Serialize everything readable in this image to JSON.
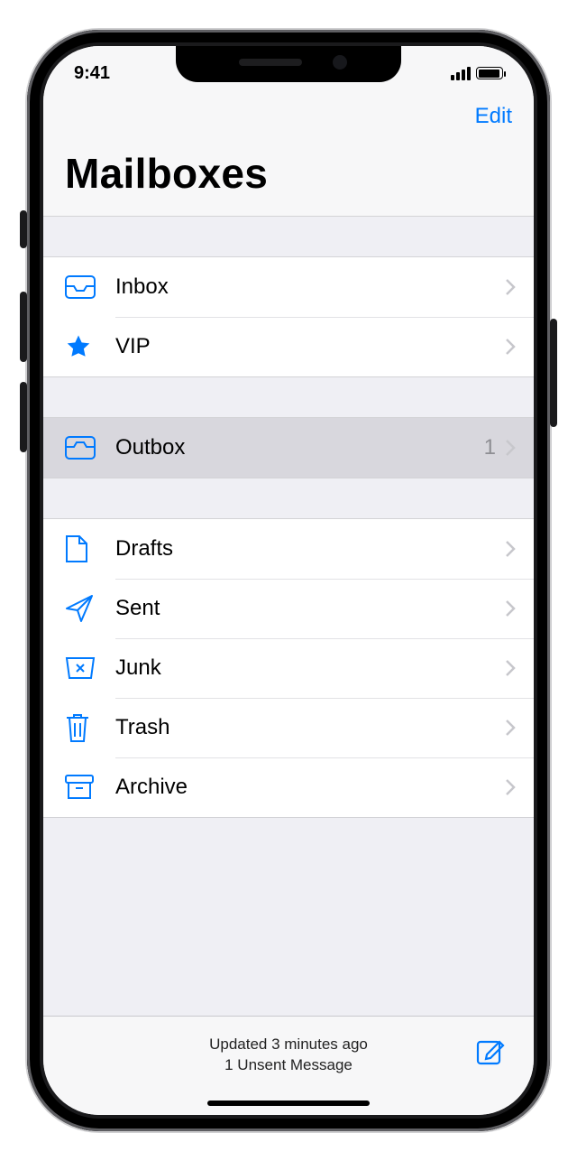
{
  "status": {
    "time": "9:41"
  },
  "nav": {
    "edit": "Edit"
  },
  "title": "Mailboxes",
  "sections": [
    {
      "rows": [
        {
          "key": "inbox",
          "label": "Inbox"
        },
        {
          "key": "vip",
          "label": "VIP"
        }
      ]
    },
    {
      "rows": [
        {
          "key": "outbox",
          "label": "Outbox",
          "count": "1",
          "selected": true
        }
      ]
    },
    {
      "rows": [
        {
          "key": "drafts",
          "label": "Drafts"
        },
        {
          "key": "sent",
          "label": "Sent"
        },
        {
          "key": "junk",
          "label": "Junk"
        },
        {
          "key": "trash",
          "label": "Trash"
        },
        {
          "key": "archive",
          "label": "Archive"
        }
      ]
    }
  ],
  "toolbar": {
    "updated": "Updated 3 minutes ago",
    "unsent": "1 Unsent Message"
  }
}
